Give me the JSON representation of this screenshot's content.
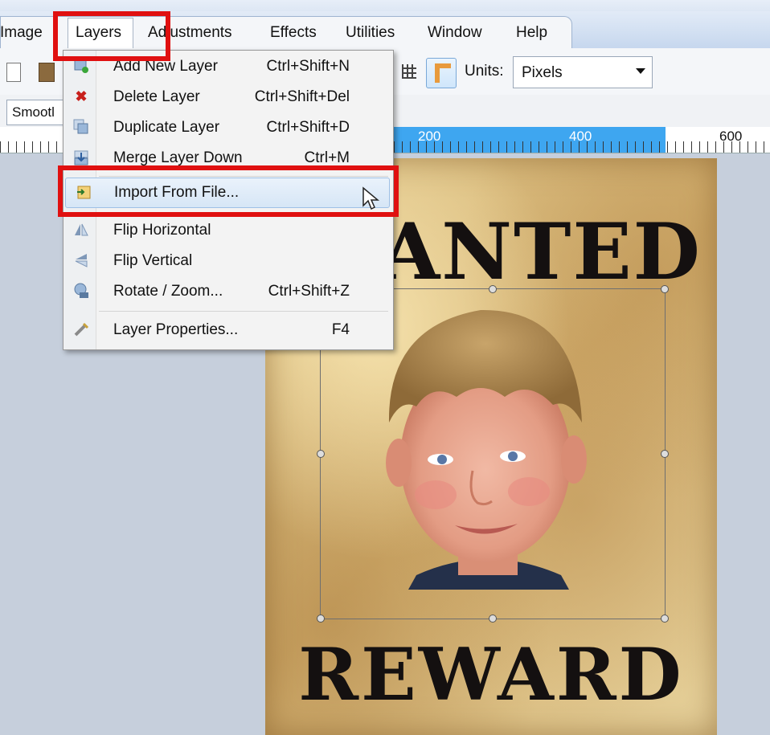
{
  "menubar": {
    "items": [
      "Image",
      "Layers",
      "Adjustments",
      "Effects",
      "Utilities",
      "Window",
      "Help"
    ]
  },
  "toolbar": {
    "units_label": "Units:",
    "units_value": "Pixels",
    "smoothing_label": "Smootl"
  },
  "ruler": {
    "labels": [
      "200",
      "400",
      "600"
    ]
  },
  "layers_menu": {
    "items": [
      {
        "label": "Add New Layer",
        "shortcut": "Ctrl+Shift+N",
        "icon": "add-layer-icon"
      },
      {
        "label": "Delete Layer",
        "shortcut": "Ctrl+Shift+Del",
        "icon": "delete-icon"
      },
      {
        "label": "Duplicate Layer",
        "shortcut": "Ctrl+Shift+D",
        "icon": "duplicate-layer-icon"
      },
      {
        "label": "Merge Layer Down",
        "shortcut": "Ctrl+M",
        "icon": "merge-down-icon"
      },
      {
        "label": "Import From File...",
        "shortcut": "",
        "icon": "import-file-icon"
      },
      {
        "label": "Flip Horizontal",
        "shortcut": "",
        "icon": "flip-horizontal-icon"
      },
      {
        "label": "Flip Vertical",
        "shortcut": "",
        "icon": "flip-vertical-icon"
      },
      {
        "label": "Rotate / Zoom...",
        "shortcut": "Ctrl+Shift+Z",
        "icon": "rotate-zoom-icon"
      },
      {
        "label": "Layer Properties...",
        "shortcut": "F4",
        "icon": "layer-properties-icon"
      }
    ],
    "highlighted": "Import From File..."
  },
  "canvas": {
    "poster_top_text": "WANTED",
    "poster_bottom_text": "REWARD"
  },
  "colors": {
    "highlight_red": "#e01010",
    "ruler_blue": "#3ea6f0",
    "workspace": "#c6cfdc"
  }
}
